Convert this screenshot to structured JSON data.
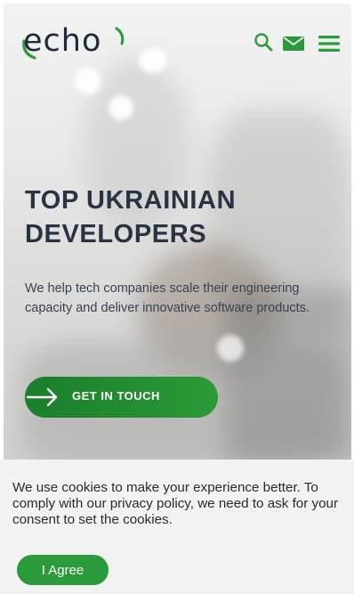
{
  "header": {
    "logo_text": "echo",
    "icons": [
      "search-icon",
      "mail-icon",
      "menu-icon"
    ]
  },
  "hero": {
    "title": "TOP UKRAINIAN DEVELOPERS",
    "description": "We help tech companies scale their engineering capacity and deliver innovative software products.",
    "cta_label": "GET IN TOUCH",
    "cta_icon": "arrow-right-icon"
  },
  "cookie_banner": {
    "text": "We use cookies to make your experience better. To comply with our privacy policy, we need to ask for your consent to set the cookies.",
    "agree_label": "I Agree"
  },
  "colors": {
    "brand_green": "#2a9a3a",
    "heading": "#2a3342",
    "banner_bg": "#f2f2f2"
  }
}
